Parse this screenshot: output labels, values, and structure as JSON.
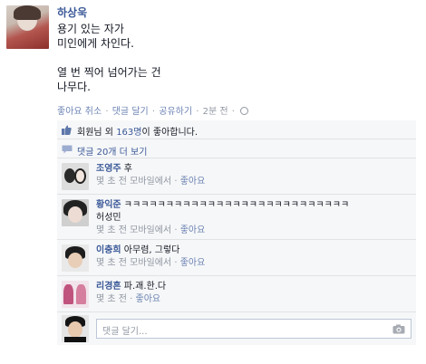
{
  "post": {
    "author": "하상욱",
    "text": "용기 있는 자가\n미인에게 차인다.\n\n열 번 찍어 넘어가는 건\n나무다.",
    "actions": {
      "like": "좋아요 취소",
      "comment": "댓글 달기",
      "share": "공유하기",
      "time": "2분 전"
    }
  },
  "feedback": {
    "likes": {
      "you": "회원님",
      "others": "외",
      "count": "163명",
      "suffix": "이 좋아합니다."
    },
    "view_more": "댓글 20개 더 보기",
    "comments": [
      {
        "name": "조영주",
        "text": "후",
        "meta": "몇 초 전 모바일에서",
        "like": "좋아요"
      },
      {
        "name": "황익준",
        "text": "ㅋㅋㅋㅋㅋㅋㅋㅋㅋㅋㅋㅋㅋㅋㅋㅋㅋㅋㅋㅋㅋㅋㅋㅋㅋㅋㅋ",
        "text2": "허성민",
        "meta": "몇 초 전 모바일에서",
        "like": "좋아요"
      },
      {
        "name": "이충희",
        "text": "아무렴, 그렇다",
        "meta": "몇 초 전 모바일에서",
        "like": "좋아요"
      },
      {
        "name": "리경흔",
        "text": "파.괘.한.다",
        "meta": "몇 초 전",
        "like": "좋아요"
      }
    ],
    "composer": {
      "placeholder": "댓글 달기..."
    }
  }
}
